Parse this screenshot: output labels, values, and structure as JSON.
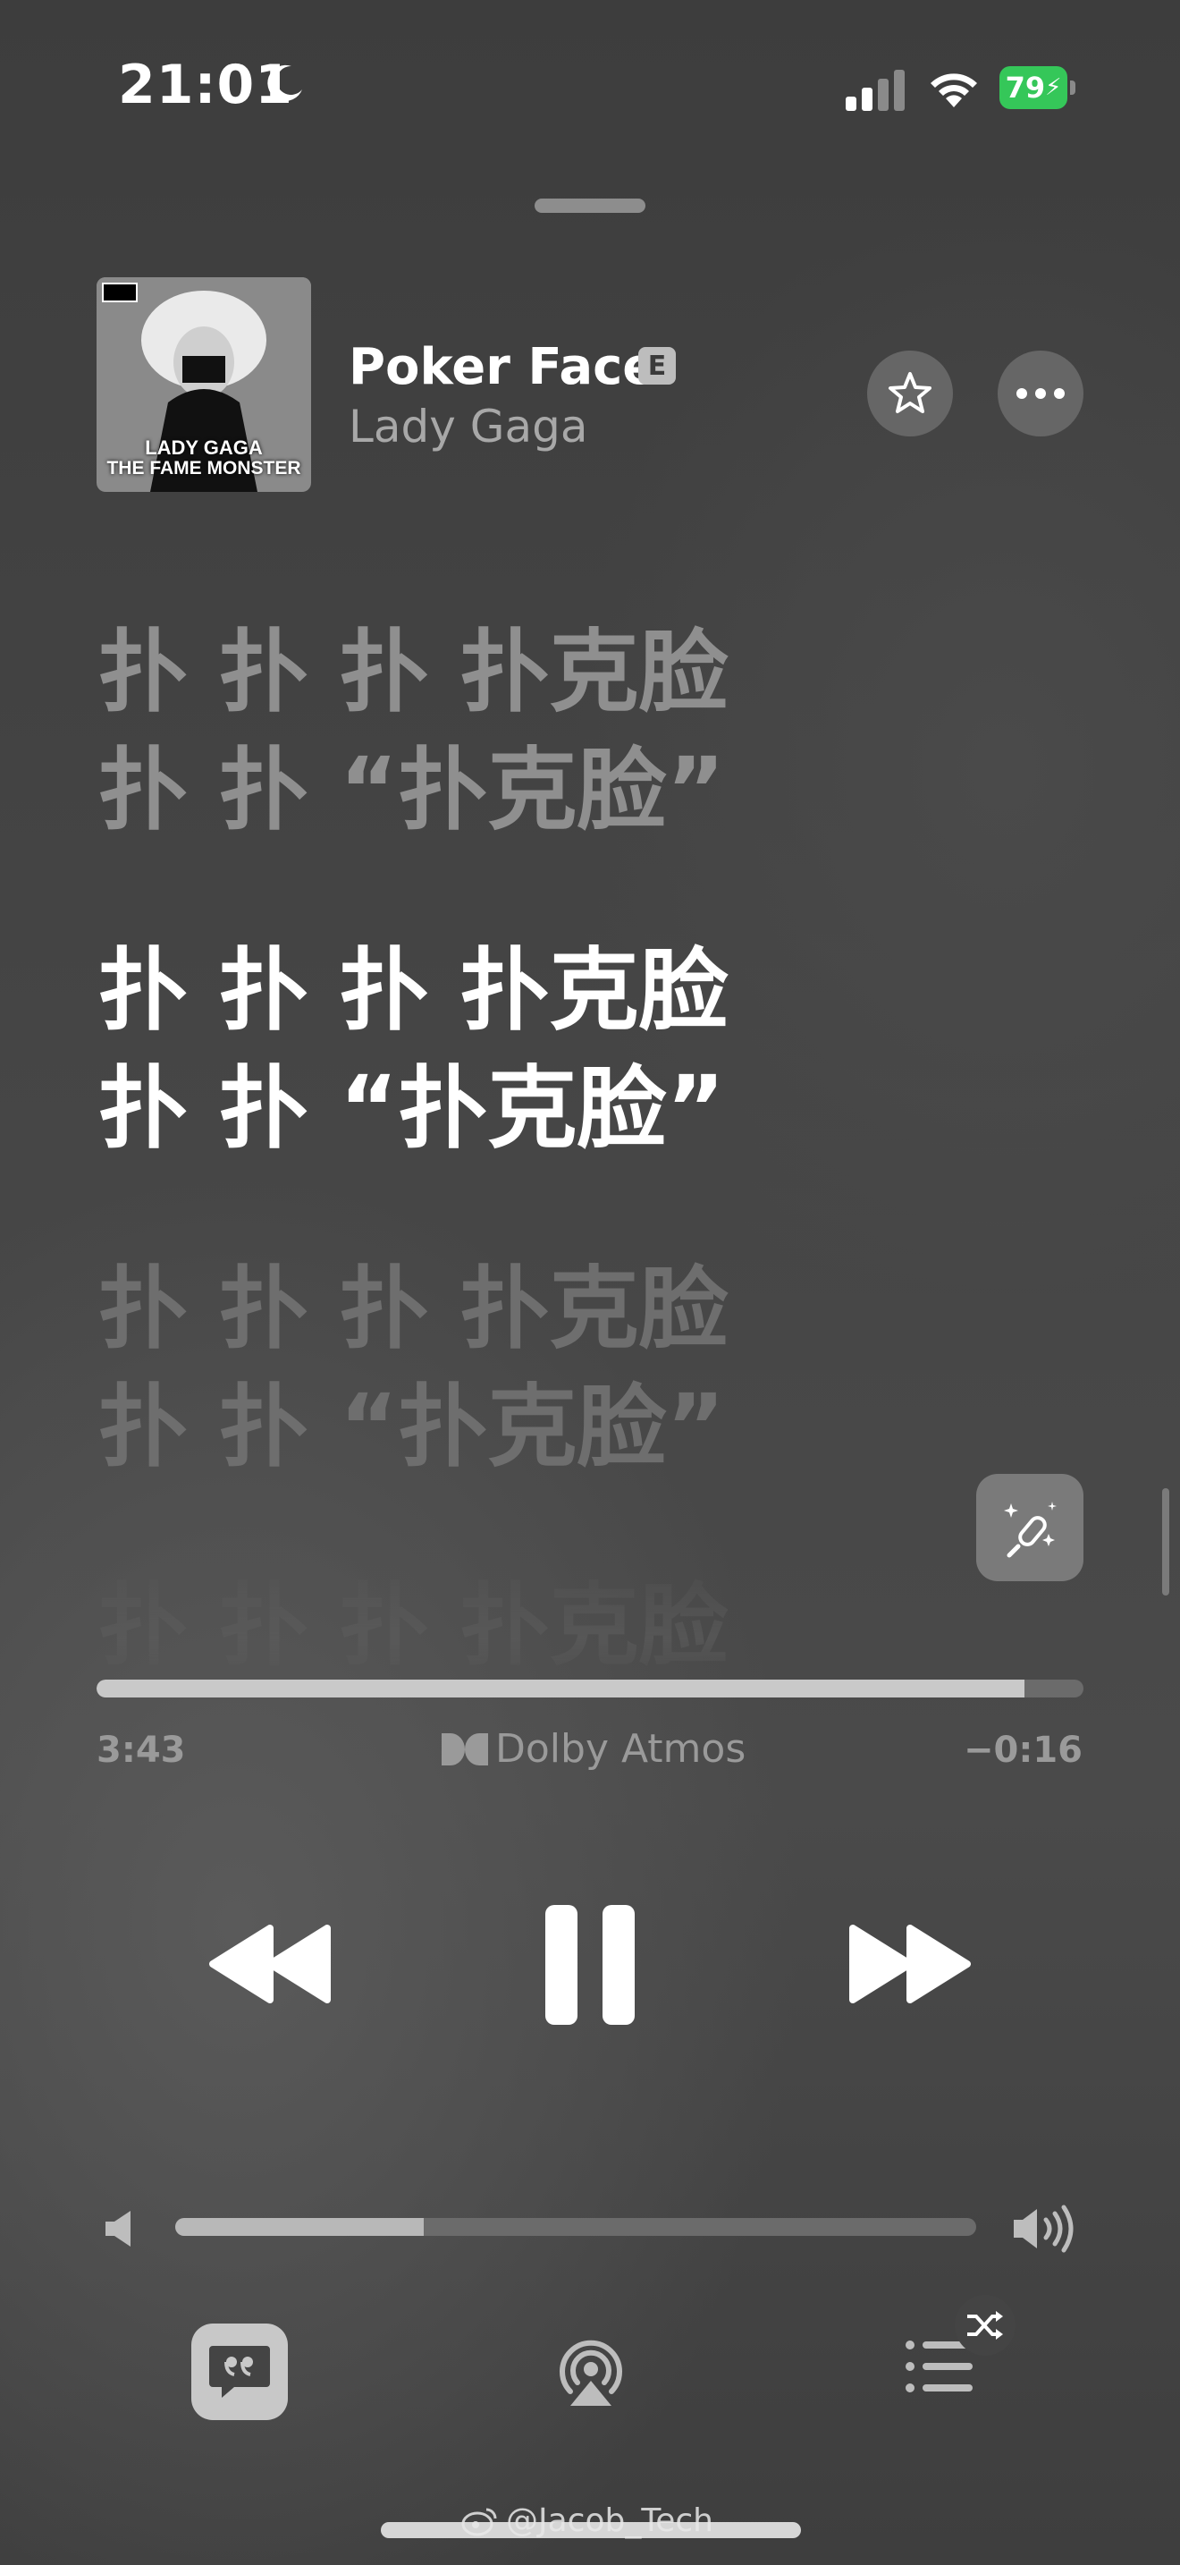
{
  "status_bar": {
    "time": "21:01",
    "battery": "79"
  },
  "now_playing": {
    "album_art_line1": "LADY GAGA",
    "album_art_line2": "THE FAME MONSTER",
    "title": "Poker Face",
    "explicit_badge": "E",
    "artist": "Lady Gaga"
  },
  "lyrics": {
    "lines": [
      {
        "text": "扑 扑 扑 扑克脸",
        "state": "past"
      },
      {
        "text": "扑 扑 “扑克脸”",
        "state": "past"
      },
      {
        "text": "扑 扑 扑 扑克脸",
        "state": "current"
      },
      {
        "text": "扑 扑 “扑克脸”",
        "state": "current"
      },
      {
        "text": "扑 扑 扑 扑克脸",
        "state": "upcoming"
      },
      {
        "text": "扑 扑 “扑克脸”",
        "state": "upcoming"
      },
      {
        "text": "扑 扑 扑 扑克脸",
        "state": "upcoming-faded"
      }
    ]
  },
  "playback": {
    "elapsed": "3:43",
    "remaining": "−0:16",
    "progress_fraction": 0.94,
    "audio_format": "Dolby Atmos",
    "state": "playing"
  },
  "volume": {
    "level_fraction": 0.31
  },
  "icons": {
    "favorite": "star-icon",
    "more": "ellipsis-icon",
    "sing": "microphone-sparkle-icon",
    "rewind": "rewind-icon",
    "pause": "pause-icon",
    "forward": "fast-forward-icon",
    "volume_low": "speaker-low-icon",
    "volume_high": "speaker-high-icon",
    "lyrics": "lyrics-quote-icon",
    "airplay": "airplay-icon",
    "queue": "queue-list-icon",
    "shuffle": "shuffle-icon"
  },
  "colors": {
    "battery": "#35c759",
    "active_lyric": "#ffffff",
    "dim_lyric": "#8f8f8f"
  },
  "watermark": "@Jacob_Tech"
}
